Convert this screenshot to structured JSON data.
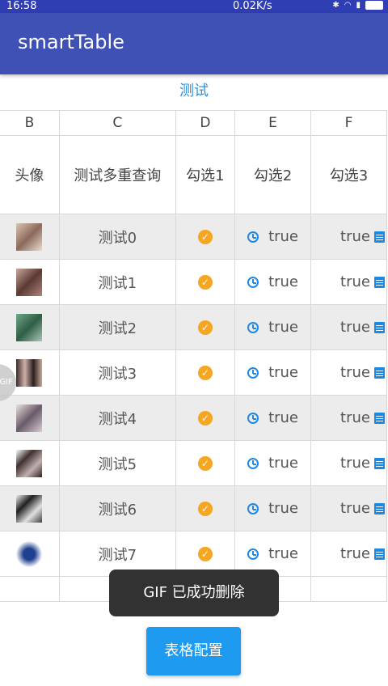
{
  "status_bar": {
    "time": "16:58",
    "net_speed": "0.02K/s"
  },
  "app_bar": {
    "title": "smartTable"
  },
  "table": {
    "title": "测试",
    "column_letters": [
      "B",
      "C",
      "D",
      "E",
      "F"
    ],
    "column_headers": [
      "头像",
      "测试多重查询",
      "勾选1",
      "勾选2",
      "勾选3"
    ],
    "rows": [
      {
        "name": "测试0",
        "check2": "true",
        "check3": "true"
      },
      {
        "name": "测试1",
        "check2": "true",
        "check3": "true"
      },
      {
        "name": "测试2",
        "check2": "true",
        "check3": "true"
      },
      {
        "name": "测试3",
        "check2": "true",
        "check3": "true"
      },
      {
        "name": "测试4",
        "check2": "true",
        "check3": "true"
      },
      {
        "name": "测试5",
        "check2": "true",
        "check3": "true"
      },
      {
        "name": "测试6",
        "check2": "true",
        "check3": "true"
      },
      {
        "name": "测试7",
        "check2": "true",
        "check3": "true"
      }
    ]
  },
  "gif_badge": "GIF",
  "toast": "GIF 已成功删除",
  "config_button": "表格配置",
  "colors": {
    "app_bar": "#3f51b5",
    "accent_blue": "#1e88e5",
    "check_orange": "#f5a623",
    "table_title": "#2b90d9",
    "button": "#1e9bf0"
  }
}
